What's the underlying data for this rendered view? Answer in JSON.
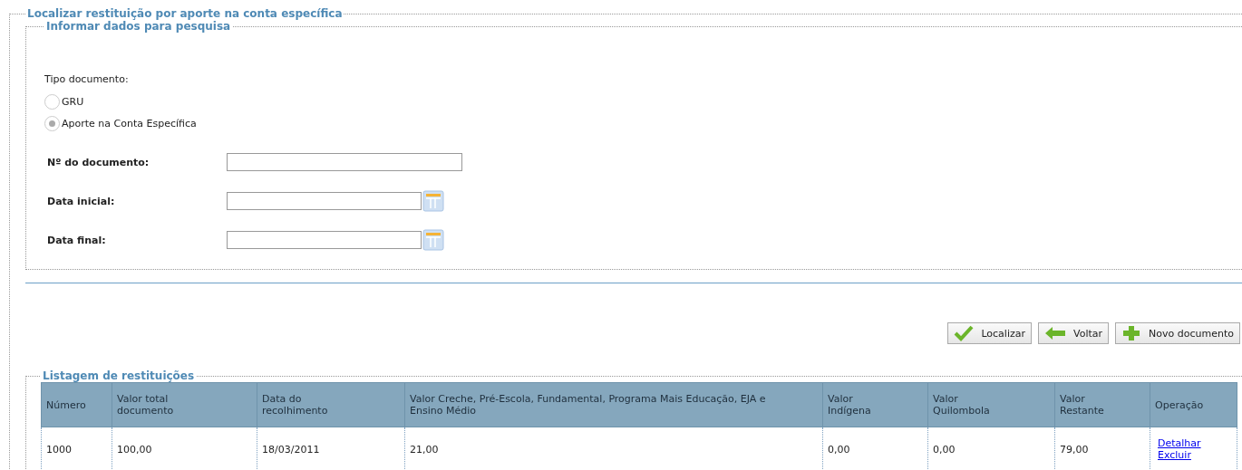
{
  "title": "Localizar restituição por aporte na conta específica",
  "search": {
    "legend": "Informar dados para pesquisa",
    "type_label": "Tipo documento:",
    "options": [
      {
        "label": "GRU",
        "selected": false
      },
      {
        "label": "Aporte na Conta Específica",
        "selected": true
      }
    ],
    "fields": [
      {
        "label": "Nº do documento:",
        "kind": "text"
      },
      {
        "label": "Data inicial:",
        "kind": "date"
      },
      {
        "label": "Data final:",
        "kind": "date"
      }
    ]
  },
  "buttons": [
    {
      "label": "Localizar",
      "kind": "check"
    },
    {
      "label": "Voltar",
      "kind": "back"
    },
    {
      "label": "Novo documento",
      "kind": "add"
    }
  ],
  "listing": {
    "legend": "Listagem de restituições",
    "columns": [
      "Número",
      "Valor total documento",
      "Data do recolhimento",
      "Valor Creche, Pré-Escola, Fundamental, Programa Mais Educação, EJA e Ensino Médio",
      "Valor Indígena",
      "Valor Quilombola",
      "Valor Restante",
      "Operação"
    ],
    "rows": [
      {
        "cells": [
          "1000",
          "100,00",
          "18/03/2011",
          "21,00",
          "0,00",
          "0,00",
          "79,00"
        ],
        "links": [
          "Detalhar",
          "Excluir"
        ]
      }
    ]
  }
}
